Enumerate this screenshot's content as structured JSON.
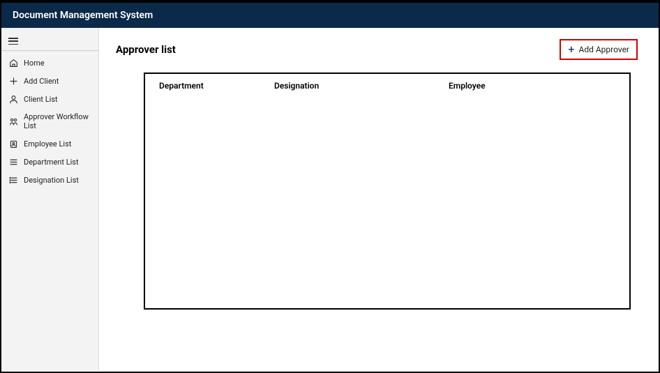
{
  "app_title": "Document Management System",
  "sidebar": {
    "items": [
      {
        "label": "Home"
      },
      {
        "label": "Add Client"
      },
      {
        "label": "Client List"
      },
      {
        "label": "Approver Workflow List"
      },
      {
        "label": "Employee List"
      },
      {
        "label": "Department List"
      },
      {
        "label": "Designation List"
      }
    ]
  },
  "page": {
    "title": "Approver list",
    "add_button_label": "Add Approver"
  },
  "table": {
    "columns": {
      "department": "Department",
      "designation": "Designation",
      "employee": "Employee"
    },
    "rows": []
  }
}
